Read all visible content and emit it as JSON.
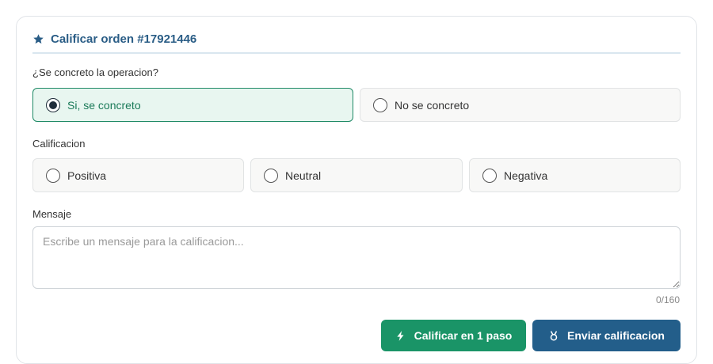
{
  "header": {
    "title": "Calificar orden #17921446",
    "icon": "star-icon"
  },
  "concreted": {
    "question": "¿Se concreto la operacion?",
    "options": [
      {
        "label": "Si, se concreto",
        "selected": true
      },
      {
        "label": "No se concreto",
        "selected": false
      }
    ]
  },
  "rating": {
    "label": "Calificacion",
    "options": [
      {
        "label": "Positiva",
        "selected": false
      },
      {
        "label": "Neutral",
        "selected": false
      },
      {
        "label": "Negativa",
        "selected": false
      }
    ]
  },
  "message": {
    "label": "Mensaje",
    "placeholder": "Escribe un mensaje para la calificacion...",
    "value": "",
    "counter": "0/160"
  },
  "actions": {
    "quick_label": "Calificar en 1 paso",
    "quick_icon": "bolt-icon",
    "send_label": "Enviar calificacion",
    "send_icon": "medal-icon"
  },
  "colors": {
    "title": "#2a5d86",
    "selected_bg": "#e8f6f0",
    "selected_border": "#1f8a66",
    "green_button": "#1a9467",
    "blue_button": "#235e8a"
  }
}
